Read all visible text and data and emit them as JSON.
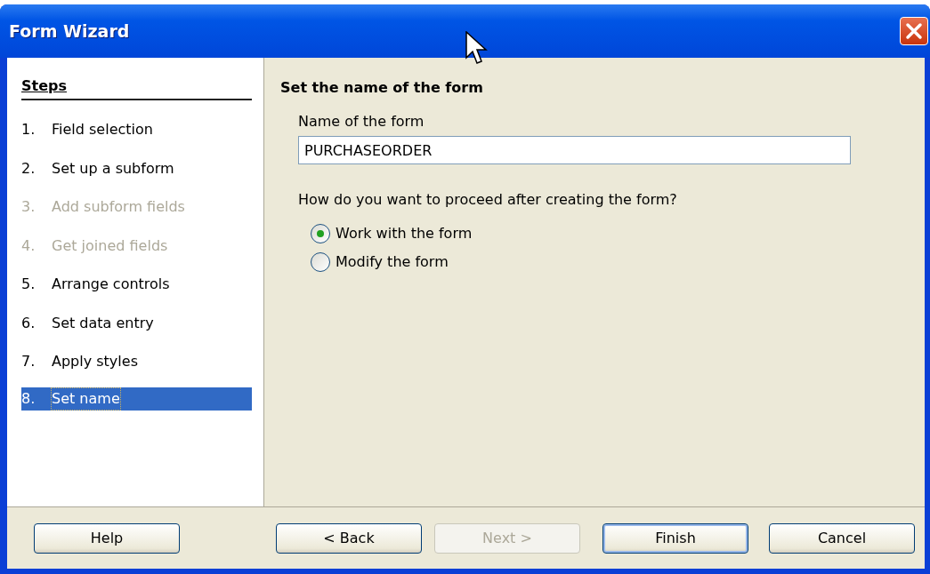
{
  "window": {
    "title": "Form Wizard"
  },
  "steps": {
    "heading": "Steps",
    "items": [
      {
        "number": "1.",
        "label": "Field selection",
        "disabled": false,
        "selected": false
      },
      {
        "number": "2.",
        "label": "Set up a subform",
        "disabled": false,
        "selected": false
      },
      {
        "number": "3.",
        "label": "Add subform fields",
        "disabled": true,
        "selected": false
      },
      {
        "number": "4.",
        "label": "Get joined fields",
        "disabled": true,
        "selected": false
      },
      {
        "number": "5.",
        "label": "Arrange controls",
        "disabled": false,
        "selected": false
      },
      {
        "number": "6.",
        "label": "Set data entry",
        "disabled": false,
        "selected": false
      },
      {
        "number": "7.",
        "label": "Apply styles",
        "disabled": false,
        "selected": false
      },
      {
        "number": "8.",
        "label": "Set name",
        "disabled": false,
        "selected": true
      }
    ]
  },
  "page": {
    "title": "Set the name of the form",
    "name_label": "Name of the form",
    "name_value": "PURCHASEORDER",
    "question": "How do you want to proceed after creating the form?",
    "options": [
      {
        "label": "Work with the form",
        "selected": true
      },
      {
        "label": "Modify the form",
        "selected": false
      }
    ]
  },
  "buttons": [
    {
      "label": "Help",
      "disabled": false,
      "default": false
    },
    {
      "label": "< Back",
      "disabled": false,
      "default": false
    },
    {
      "label": "Next >",
      "disabled": true,
      "default": false
    },
    {
      "label": "Finish",
      "disabled": false,
      "default": true
    },
    {
      "label": "Cancel",
      "disabled": false,
      "default": false
    }
  ]
}
